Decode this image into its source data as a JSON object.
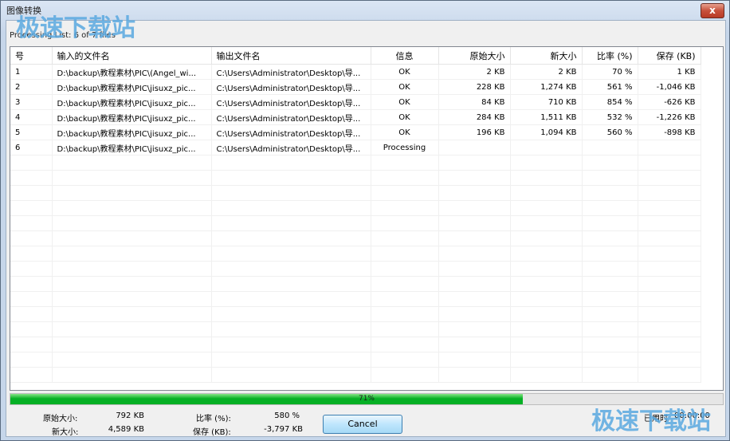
{
  "window": {
    "title": "图像转换",
    "close_label": "x"
  },
  "processing_text": "Processing List: 6 of 7 files",
  "columns": [
    "号",
    "输入的文件名",
    "输出文件名",
    "信息",
    "原始大小",
    "新大小",
    "比率 (%)",
    "保存 (KB)"
  ],
  "rows": [
    [
      "1",
      "D:\\backup\\教程素材\\PIC\\(Angel_wi...",
      "C:\\Users\\Administrator\\Desktop\\导...",
      "OK",
      "2 KB",
      "2 KB",
      "70 %",
      "1 KB"
    ],
    [
      "2",
      "D:\\backup\\教程素材\\PIC\\jisuxz_pic...",
      "C:\\Users\\Administrator\\Desktop\\导...",
      "OK",
      "228 KB",
      "1,274 KB",
      "561 %",
      "-1,046 KB"
    ],
    [
      "3",
      "D:\\backup\\教程素材\\PIC\\jisuxz_pic...",
      "C:\\Users\\Administrator\\Desktop\\导...",
      "OK",
      "84 KB",
      "710 KB",
      "854 %",
      "-626 KB"
    ],
    [
      "4",
      "D:\\backup\\教程素材\\PIC\\jisuxz_pic...",
      "C:\\Users\\Administrator\\Desktop\\导...",
      "OK",
      "284 KB",
      "1,511 KB",
      "532 %",
      "-1,226 KB"
    ],
    [
      "5",
      "D:\\backup\\教程素材\\PIC\\jisuxz_pic...",
      "C:\\Users\\Administrator\\Desktop\\导...",
      "OK",
      "196 KB",
      "1,094 KB",
      "560 %",
      "-898 KB"
    ],
    [
      "6",
      "D:\\backup\\教程素材\\PIC\\jisuxz_pic...",
      "C:\\Users\\Administrator\\Desktop\\导...",
      "Processing",
      "",
      "",
      "",
      ""
    ]
  ],
  "progress": {
    "value": 0.71,
    "label": "71%",
    "color": "#06b025"
  },
  "stats": {
    "orig_label": "原始大小:",
    "orig_value": "792 KB",
    "new_label": "新大小:",
    "new_value": "4,589 KB",
    "ratio_label": "比率  (%):",
    "ratio_value": "580 %",
    "saved_label": "保存  (KB):",
    "saved_value": "-3,797 KB",
    "elapsed_label": "已用时",
    "elapsed_value": "00:00:00"
  },
  "cancel_label": "Cancel",
  "watermark": "极速下载站"
}
